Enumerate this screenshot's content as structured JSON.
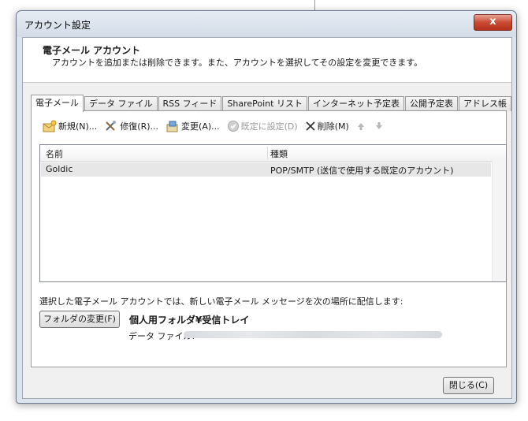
{
  "window": {
    "title": "アカウント設定",
    "close_glyph": "x"
  },
  "header": {
    "title": "電子メール アカウント",
    "description": "アカウントを追加または削除できます。また、アカウントを選択してその設定を変更できます。"
  },
  "tabs": [
    {
      "label": "電子メール",
      "active": true
    },
    {
      "label": "データ ファイル"
    },
    {
      "label": "RSS フィード"
    },
    {
      "label": "SharePoint リスト"
    },
    {
      "label": "インターネット予定表"
    },
    {
      "label": "公開予定表"
    },
    {
      "label": "アドレス帳"
    }
  ],
  "toolbar": {
    "new_label": "新規(N)...",
    "repair_label": "修復(R)...",
    "change_label": "変更(A)...",
    "default_label": "既定に設定(D)",
    "delete_label": "削除(M)",
    "up_icon": "arrow-up-icon",
    "down_icon": "arrow-down-icon"
  },
  "list": {
    "columns": [
      "名前",
      "種類"
    ],
    "rows": [
      {
        "name": "Goldic",
        "type": "POP/SMTP (送信で使用する既定のアカウント)"
      }
    ]
  },
  "delivery": {
    "text": "選択した電子メール アカウントでは、新しい電子メール メッセージを次の場所に配信します:",
    "folder_button": "フォルダの変更(F)",
    "folder_path": "個人用フォルダ¥受信トレイ",
    "data_file_label": "データ ファイル:"
  },
  "footer": {
    "close_label": "閉じる(C)"
  },
  "colors": {
    "close_button": "#c94b33",
    "window_frame": "#dce4ee",
    "selected_row": "#e7e7e7"
  }
}
